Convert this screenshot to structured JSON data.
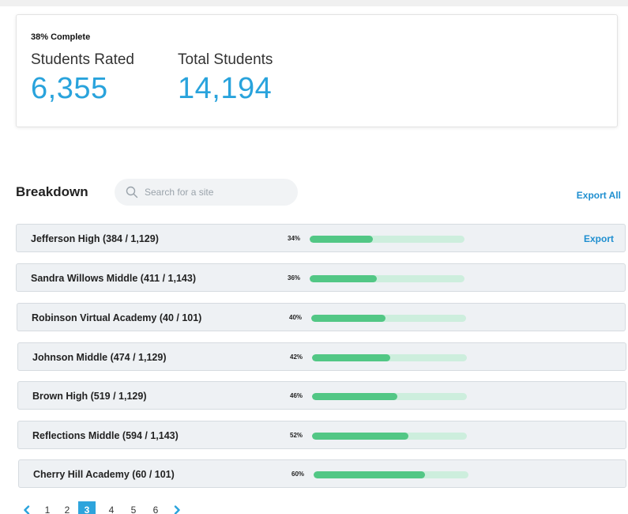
{
  "summary": {
    "complete_label": "38% Complete",
    "rated_label": "Students Rated",
    "rated_value": "6,355",
    "total_label": "Total Students",
    "total_value": "14,194"
  },
  "breakdown": {
    "title": "Breakdown",
    "search_placeholder": "Search for a site",
    "search_value": "",
    "export_all_label": "Export All"
  },
  "rows": [
    {
      "name": "Jefferson High (384 / 1,129)",
      "percent_label": "34%",
      "progress": 0.34,
      "export_label": "Export"
    },
    {
      "name": "Sandra Willows Middle (411 / 1,143)",
      "percent_label": "36%",
      "progress": 0.36,
      "export_label": ""
    },
    {
      "name": "Robinson Virtual Academy (40 / 101)",
      "percent_label": "40%",
      "progress": 0.4,
      "export_label": ""
    },
    {
      "name": "Johnson Middle (474 / 1,129)",
      "percent_label": "42%",
      "progress": 0.42,
      "export_label": ""
    },
    {
      "name": "Brown High (519 / 1,129)",
      "percent_label": "46%",
      "progress": 0.46,
      "export_label": ""
    },
    {
      "name": "Reflections Middle (594 / 1,143)",
      "percent_label": "52%",
      "progress": 0.52,
      "export_label": ""
    },
    {
      "name": "Cherry Hill Academy (60 / 101)",
      "percent_label": "60%",
      "progress": 0.6,
      "export_label": ""
    }
  ],
  "pagination": {
    "prev_icon": "chevron-left-icon",
    "next_icon": "chevron-right-icon",
    "pages": [
      "1",
      "2",
      "3",
      "4",
      "5",
      "6"
    ],
    "current": "3"
  },
  "colors": {
    "accent": "#29a3dc",
    "link": "#1f8fd0",
    "progress_fill": "#52c785",
    "progress_track": "#cdeedd",
    "row_bg": "#eef1f4"
  }
}
